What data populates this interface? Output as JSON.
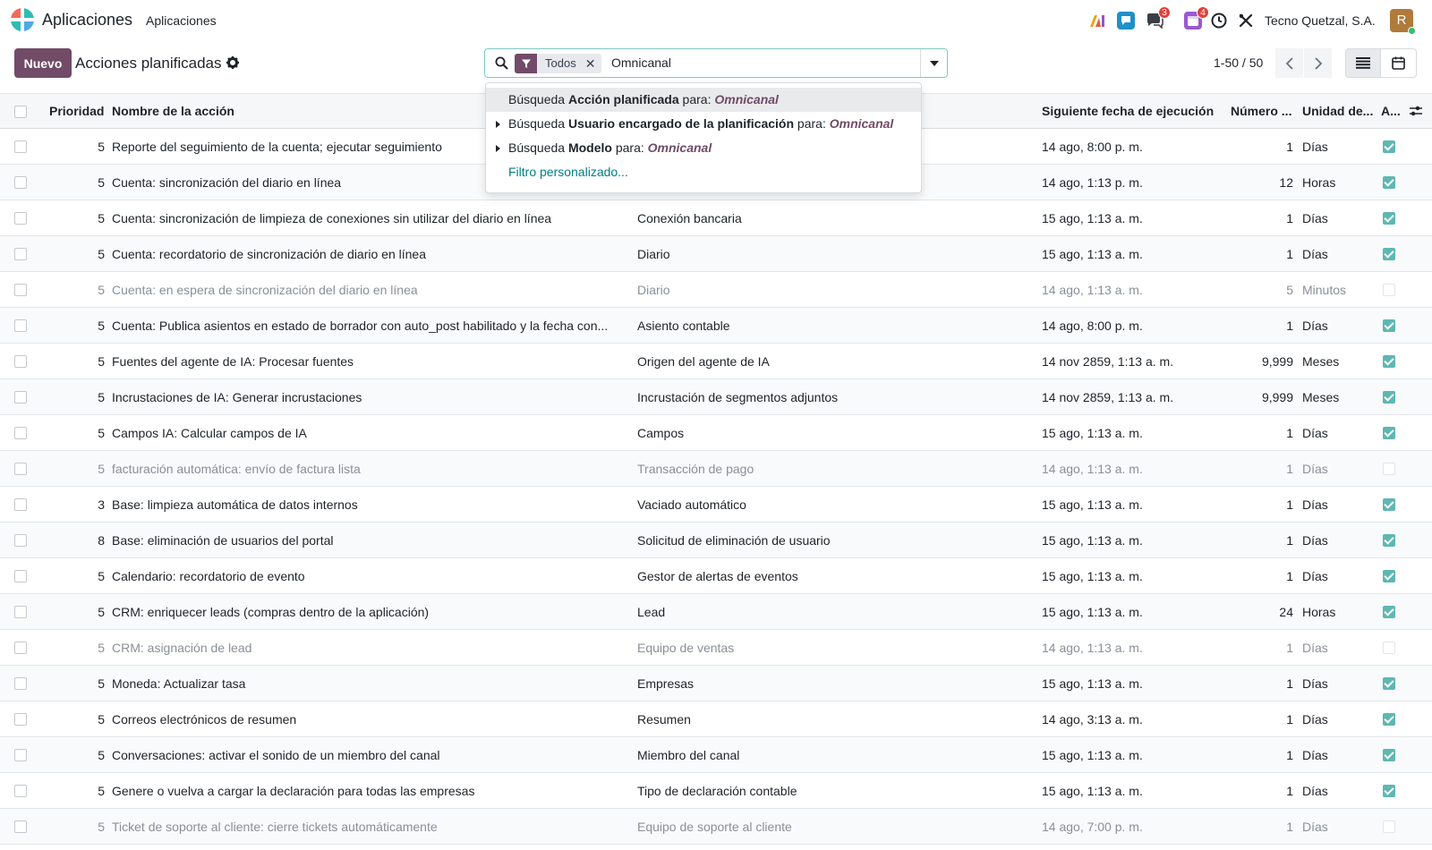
{
  "navbar": {
    "app_title": "Aplicaciones",
    "menu_item": "Aplicaciones",
    "chat_badge": "3",
    "activity_badge": "4",
    "company": "Tecno Quetzal, S.A.",
    "avatar_initial": "R",
    "icons": [
      "ai-icon",
      "discuss-icon",
      "messages-icon",
      "activities-icon",
      "clock-icon",
      "debug-tools-icon"
    ]
  },
  "control": {
    "new_button": "Nuevo",
    "title": "Acciones planificadas",
    "pager": "1-50 / 50"
  },
  "search": {
    "facet_label": "Todos",
    "query": "Omnicanal"
  },
  "dropdown": {
    "items": [
      {
        "prefix": "Búsqueda ",
        "field": "Acción planificada",
        "mid": " para: ",
        "term": "Omnicanal"
      },
      {
        "prefix": "Búsqueda ",
        "field": "Usuario encargado de la planificación",
        "mid": " para: ",
        "term": "Omnicanal"
      },
      {
        "prefix": "Búsqueda ",
        "field": "Modelo",
        "mid": " para: ",
        "term": "Omnicanal"
      }
    ],
    "custom_filter": "Filtro personalizado..."
  },
  "table": {
    "headers": {
      "priority": "Prioridad",
      "name": "Nombre de la acción",
      "next_exec": "Siguiente fecha de ejecución",
      "number": "Número ...",
      "unit": "Unidad de...",
      "active": "A..."
    },
    "rows": [
      {
        "priority": "5",
        "name": "Reporte del seguimiento de la cuenta; ejecutar seguimiento",
        "model": "",
        "next": "14 ago, 8:00 p. m.",
        "number": "1",
        "unit": "Días",
        "active": true
      },
      {
        "priority": "5",
        "name": "Cuenta: sincronización del diario en línea",
        "model": "",
        "next": "14 ago, 1:13 p. m.",
        "number": "12",
        "unit": "Horas",
        "active": true
      },
      {
        "priority": "5",
        "name": "Cuenta: sincronización de limpieza de conexiones sin utilizar del diario en línea",
        "model": "Conexión bancaria",
        "next": "15 ago, 1:13 a. m.",
        "number": "1",
        "unit": "Días",
        "active": true
      },
      {
        "priority": "5",
        "name": "Cuenta: recordatorio de sincronización de diario en línea",
        "model": "Diario",
        "next": "15 ago, 1:13 a. m.",
        "number": "1",
        "unit": "Días",
        "active": true
      },
      {
        "priority": "5",
        "name": "Cuenta: en espera de sincronización del diario en línea",
        "model": "Diario",
        "next": "14 ago, 1:13 a. m.",
        "number": "5",
        "unit": "Minutos",
        "active": false
      },
      {
        "priority": "5",
        "name": "Cuenta: Publica asientos en estado de borrador con auto_post habilitado y la fecha con...",
        "model": "Asiento contable",
        "next": "14 ago, 8:00 p. m.",
        "number": "1",
        "unit": "Días",
        "active": true
      },
      {
        "priority": "5",
        "name": "Fuentes del agente de IA: Procesar fuentes",
        "model": "Origen del agente de IA",
        "next": "14 nov 2859, 1:13 a. m.",
        "number": "9,999",
        "unit": "Meses",
        "active": true
      },
      {
        "priority": "5",
        "name": "Incrustaciones de IA: Generar incrustaciones",
        "model": "Incrustación de segmentos adjuntos",
        "next": "14 nov 2859, 1:13 a. m.",
        "number": "9,999",
        "unit": "Meses",
        "active": true
      },
      {
        "priority": "5",
        "name": "Campos IA: Calcular campos de IA",
        "model": "Campos",
        "next": "15 ago, 1:13 a. m.",
        "number": "1",
        "unit": "Días",
        "active": true
      },
      {
        "priority": "5",
        "name": "facturación automática: envío de factura lista",
        "model": "Transacción de pago",
        "next": "14 ago, 1:13 a. m.",
        "number": "1",
        "unit": "Días",
        "active": false
      },
      {
        "priority": "3",
        "name": "Base: limpieza automática de datos internos",
        "model": "Vaciado automático",
        "next": "15 ago, 1:13 a. m.",
        "number": "1",
        "unit": "Días",
        "active": true
      },
      {
        "priority": "8",
        "name": "Base: eliminación de usuarios del portal",
        "model": "Solicitud de eliminación de usuario",
        "next": "15 ago, 1:13 a. m.",
        "number": "1",
        "unit": "Días",
        "active": true
      },
      {
        "priority": "5",
        "name": "Calendario: recordatorio de evento",
        "model": "Gestor de alertas de eventos",
        "next": "15 ago, 1:13 a. m.",
        "number": "1",
        "unit": "Días",
        "active": true
      },
      {
        "priority": "5",
        "name": "CRM: enriquecer leads (compras dentro de la aplicación)",
        "model": "Lead",
        "next": "15 ago, 1:13 a. m.",
        "number": "24",
        "unit": "Horas",
        "active": true
      },
      {
        "priority": "5",
        "name": "CRM: asignación de lead",
        "model": "Equipo de ventas",
        "next": "14 ago, 1:13 a. m.",
        "number": "1",
        "unit": "Días",
        "active": false
      },
      {
        "priority": "5",
        "name": "Moneda: Actualizar tasa",
        "model": "Empresas",
        "next": "15 ago, 1:13 a. m.",
        "number": "1",
        "unit": "Días",
        "active": true
      },
      {
        "priority": "5",
        "name": "Correos electrónicos de resumen",
        "model": "Resumen",
        "next": "14 ago, 3:13 a. m.",
        "number": "1",
        "unit": "Días",
        "active": true
      },
      {
        "priority": "5",
        "name": "Conversaciones: activar el sonido de un miembro del canal",
        "model": "Miembro del canal",
        "next": "15 ago, 1:13 a. m.",
        "number": "1",
        "unit": "Días",
        "active": true
      },
      {
        "priority": "5",
        "name": "Genere o vuelva a cargar la declaración para todas las empresas",
        "model": "Tipo de declaración contable",
        "next": "15 ago, 1:13 a. m.",
        "number": "1",
        "unit": "Días",
        "active": true
      },
      {
        "priority": "5",
        "name": "Ticket de soporte al cliente: cierre tickets automáticamente",
        "model": "Equipo de soporte al cliente",
        "next": "14 ago, 7:00 p. m.",
        "number": "1",
        "unit": "Días",
        "active": false
      }
    ]
  },
  "colors": {
    "brand": "#714b67",
    "accent": "#017e84",
    "active_check": "#5fb7b2",
    "badge": "#e0413c"
  }
}
